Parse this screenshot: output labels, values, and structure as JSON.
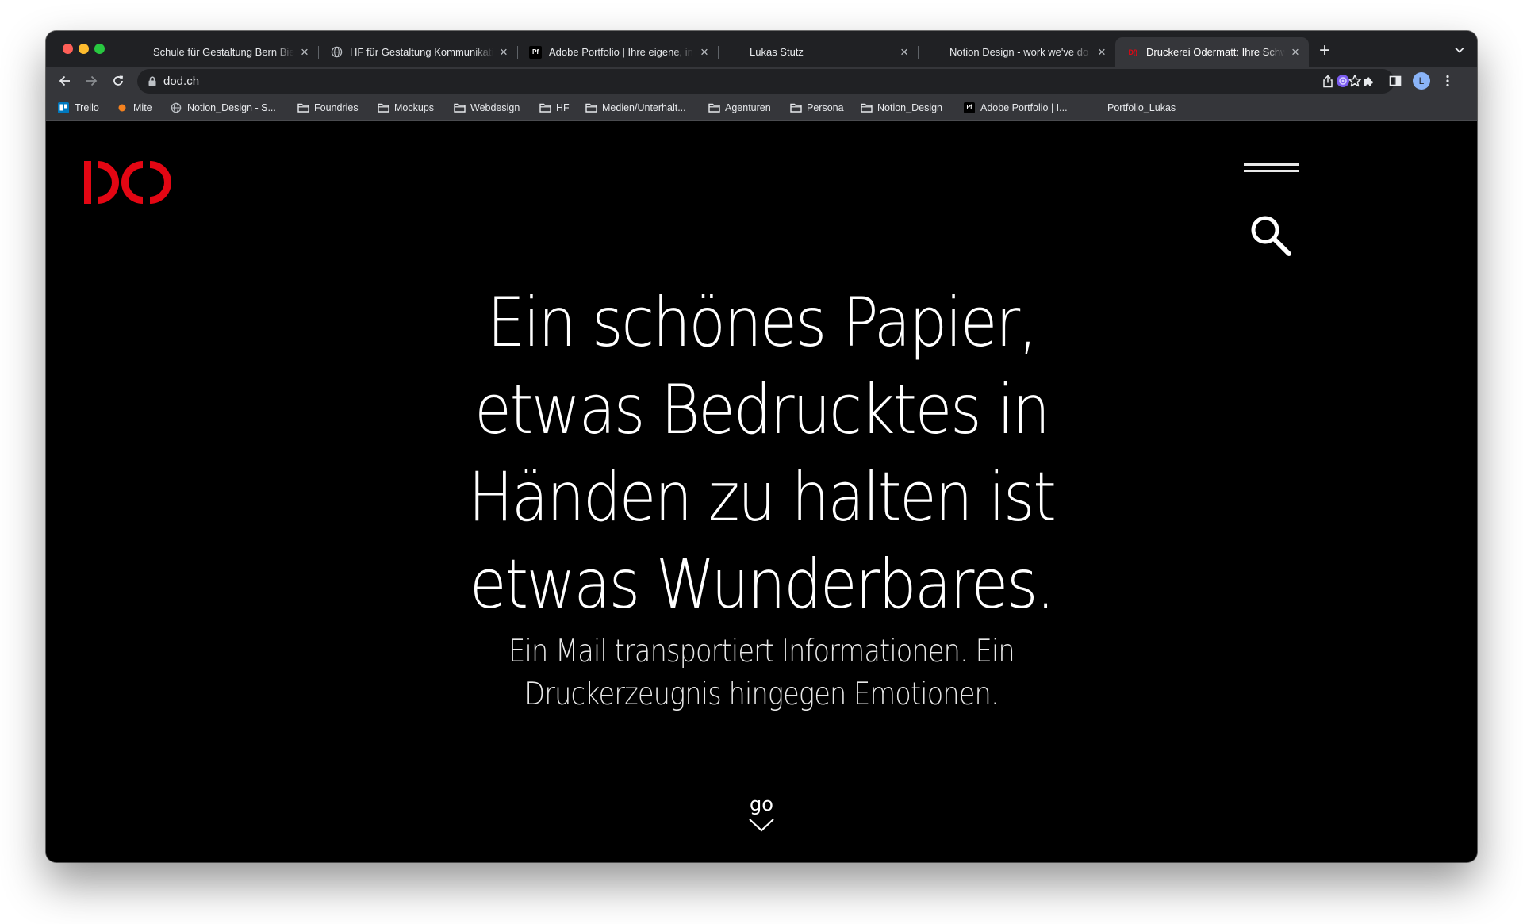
{
  "browser": {
    "tabs": [
      {
        "title": "Schule für Gestaltung Bern Biel",
        "favicon": "sfgb-icon",
        "active": false
      },
      {
        "title": "HF für Gestaltung Kommunikation",
        "favicon": "globe-icon",
        "active": false
      },
      {
        "title": "Adobe Portfolio | Ihre eigene, ind",
        "favicon": "Pf",
        "active": false
      },
      {
        "title": "Lukas Stutz",
        "favicon": "",
        "active": false
      },
      {
        "title": "Notion Design - work we've do",
        "favicon": "",
        "active": false
      },
      {
        "title": "Druckerei Odermatt: Ihre Schw",
        "favicon": "DO",
        "active": true
      }
    ],
    "new_tab": "+",
    "url": "dod.ch",
    "profile_initial": "L",
    "bookmarks": [
      {
        "label": "Trello",
        "icon": "trello-icon"
      },
      {
        "label": "Mite",
        "icon": "mite-icon"
      },
      {
        "label": "Notion_Design - S...",
        "icon": "globe-icon"
      },
      {
        "label": "Foundries",
        "icon": "folder-icon"
      },
      {
        "label": "Mockups",
        "icon": "folder-icon"
      },
      {
        "label": "Webdesign",
        "icon": "folder-icon"
      },
      {
        "label": "HF",
        "icon": "folder-icon"
      },
      {
        "label": "Medien/Unterhalt...",
        "icon": "folder-icon"
      },
      {
        "label": "Agenturen",
        "icon": "folder-icon"
      },
      {
        "label": "Persona",
        "icon": "folder-icon"
      },
      {
        "label": "Notion_Design",
        "icon": "folder-icon"
      },
      {
        "label": "Adobe Portfolio | I...",
        "icon": "Pf"
      },
      {
        "label": "Portfolio_Lukas",
        "icon": ""
      }
    ]
  },
  "page": {
    "brand_color": "#e30613",
    "hero_lines": [
      "Ein schönes Papier,",
      "etwas Bedrucktes in",
      "Händen zu halten ist",
      "etwas Wunderbares."
    ],
    "sub_lines": [
      "Ein Mail transportiert Informationen. Ein",
      "Druckerzeugnis hingegen Emotionen."
    ],
    "scroll_label": "go"
  }
}
